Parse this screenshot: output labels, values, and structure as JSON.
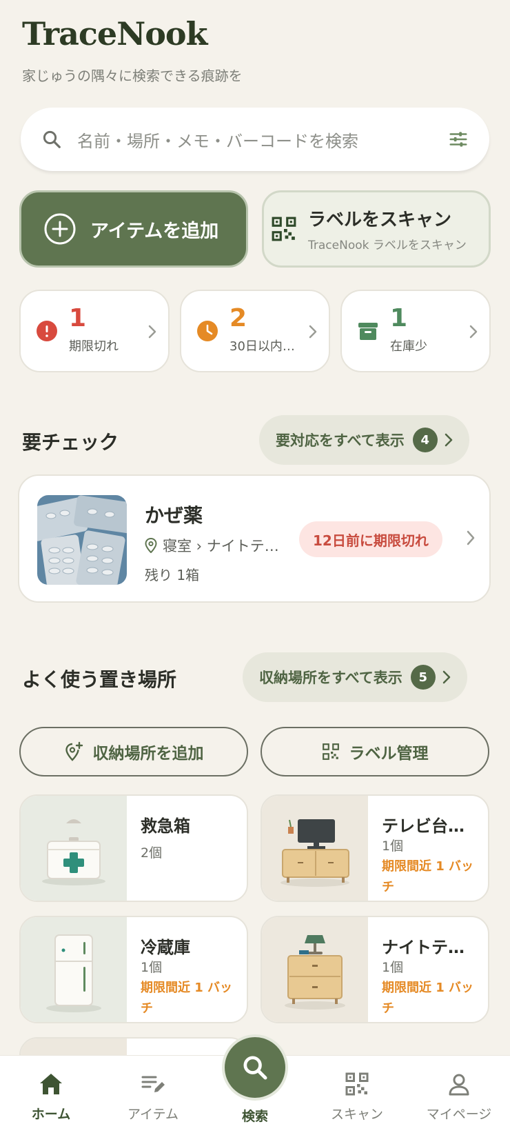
{
  "app": {
    "title": "TraceNook",
    "subtitle": "家じゅうの隅々に検索できる痕跡を"
  },
  "search": {
    "placeholder": "名前・場所・メモ・バーコードを検索"
  },
  "actions": {
    "add_item": "アイテムを追加",
    "scan_label": "ラベルをスキャン",
    "scan_sub": "TraceNook ラベルをスキャン"
  },
  "stats": [
    {
      "count": "1",
      "label": "期限切れ",
      "color": "#d84a3e"
    },
    {
      "count": "2",
      "label": "30日以内…",
      "color": "#e58a25"
    },
    {
      "count": "1",
      "label": "在庫少",
      "color": "#5a8a5a"
    }
  ],
  "attention": {
    "title": "要チェック",
    "view_all": "要対応をすべて表示",
    "count": "4",
    "item": {
      "name": "かぜ薬",
      "location": "寝室 › ナイトテ…",
      "quantity": "残り 1箱",
      "status": "12日前に期限切れ"
    }
  },
  "places": {
    "title": "よく使う置き場所",
    "view_all": "収納場所をすべて表示",
    "count": "5",
    "add_place": "収納場所を追加",
    "manage_labels": "ラベル管理",
    "items": [
      {
        "name": "救急箱",
        "count": "2個",
        "warning": ""
      },
      {
        "name": "テレビ台…",
        "count": "1個",
        "warning": "期限間近 1 バッチ"
      },
      {
        "name": "冷蔵庫",
        "count": "1個",
        "warning": "期限間近 1 バッチ"
      },
      {
        "name": "ナイトテ…",
        "count": "1個",
        "warning": "期限間近 1 バッチ"
      }
    ]
  },
  "nav": {
    "home": "ホーム",
    "items": "アイテム",
    "search": "検索",
    "scan": "スキャン",
    "mypage": "マイページ"
  },
  "colors": {
    "primary": "#5f7550",
    "background": "#f5f2eb",
    "danger": "#d84a3e",
    "warning": "#e58a25"
  }
}
